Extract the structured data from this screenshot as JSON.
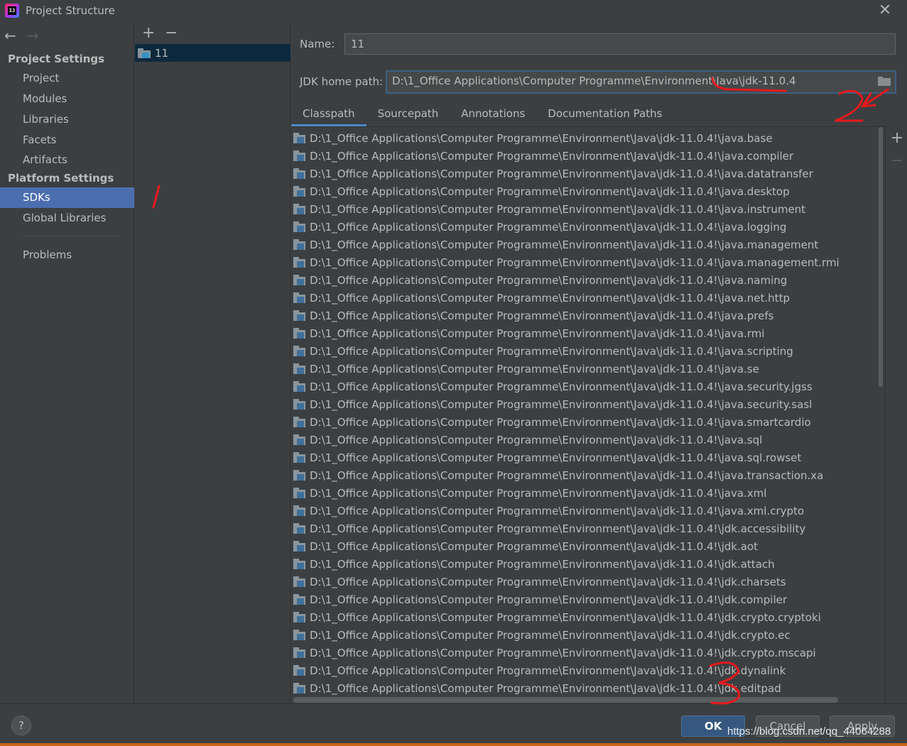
{
  "window": {
    "title": "Project Structure"
  },
  "nav": {
    "project_settings_header": "Project Settings",
    "project_items": [
      {
        "label": "Project"
      },
      {
        "label": "Modules"
      },
      {
        "label": "Libraries"
      },
      {
        "label": "Facets"
      },
      {
        "label": "Artifacts"
      }
    ],
    "platform_settings_header": "Platform Settings",
    "platform_items": [
      {
        "label": "SDKs",
        "selected": true
      },
      {
        "label": "Global Libraries"
      }
    ],
    "problems_label": "Problems"
  },
  "sdk_list": {
    "add_symbol": "+",
    "remove_symbol": "−",
    "items": [
      {
        "label": "11",
        "selected": true
      }
    ]
  },
  "sdk_detail": {
    "name_label": "Name:",
    "name_value": "11",
    "jdk_home_label": "JDK home path:",
    "jdk_home_value": "D:\\1_Office Applications\\Computer Programme\\Environment\\Java\\jdk-11.0.4",
    "tabs": [
      {
        "label": "Classpath",
        "active": true
      },
      {
        "label": "Sourcepath"
      },
      {
        "label": "Annotations"
      },
      {
        "label": "Documentation Paths"
      }
    ],
    "classpath_prefix": "D:\\1_Office Applications\\Computer Programme\\Environment\\Java\\jdk-11.0.4!\\",
    "classpath_modules": [
      "java.base",
      "java.compiler",
      "java.datatransfer",
      "java.desktop",
      "java.instrument",
      "java.logging",
      "java.management",
      "java.management.rmi",
      "java.naming",
      "java.net.http",
      "java.prefs",
      "java.rmi",
      "java.scripting",
      "java.se",
      "java.security.jgss",
      "java.security.sasl",
      "java.smartcardio",
      "java.sql",
      "java.sql.rowset",
      "java.transaction.xa",
      "java.xml",
      "java.xml.crypto",
      "jdk.accessibility",
      "jdk.aot",
      "jdk.attach",
      "jdk.charsets",
      "jdk.compiler",
      "jdk.crypto.cryptoki",
      "jdk.crypto.ec",
      "jdk.crypto.mscapi",
      "jdk.dynalink",
      "jdk.editpad"
    ],
    "side_add_symbol": "+",
    "side_remove_symbol": "−"
  },
  "footer": {
    "help_symbol": "?",
    "ok_label": "OK",
    "cancel_label": "Cancel",
    "apply_label": "Apply",
    "watermark": "https://blog.csdn.net/qq_44064288"
  },
  "icons": {
    "back": "arrow-left-icon",
    "forward": "arrow-right-icon",
    "close": "close-icon",
    "folder": "sdk-folder-icon",
    "jar": "jar-folder-icon",
    "browse": "browse-folder-icon"
  },
  "colors": {
    "background": "#3c3f41",
    "selection": "#4b6eaf",
    "list_selection": "#0d293e",
    "tab_underline": "#4a88c7",
    "primary_button": "#365880",
    "annotation_red": "#e8191d"
  }
}
